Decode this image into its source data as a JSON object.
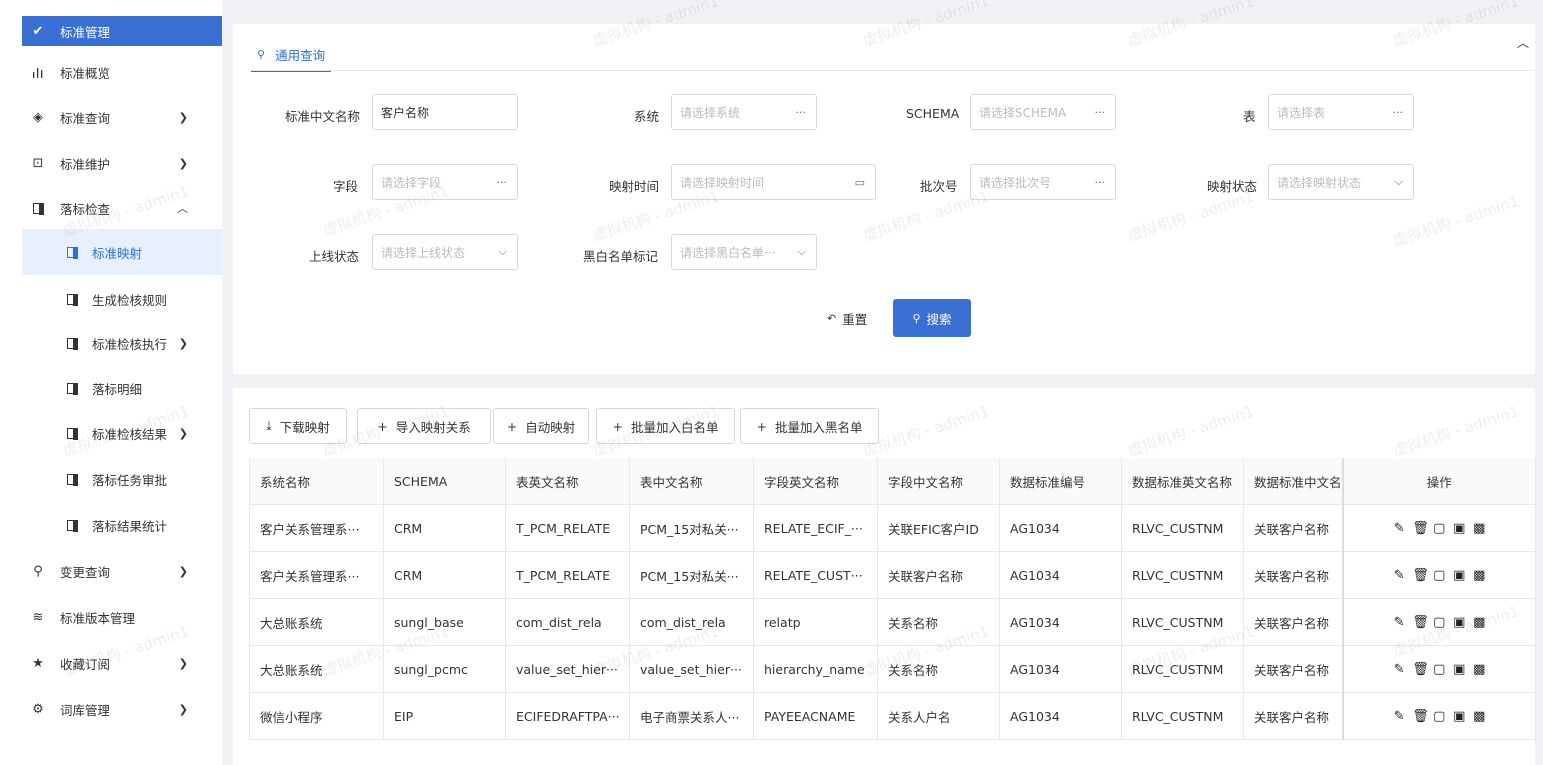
{
  "sidebar": {
    "items": [
      {
        "label": "标准管理",
        "icon": "shield-check-icon"
      },
      {
        "label": "标准概览",
        "icon": "bar-chart-icon"
      },
      {
        "label": "标准查询",
        "icon": "target-icon"
      },
      {
        "label": "标准维护",
        "icon": "box-icon"
      },
      {
        "label": "落标检查",
        "icon": "doc-icon"
      },
      {
        "label": "标准映射",
        "icon": "doc-icon"
      },
      {
        "label": "生成检核规则",
        "icon": "doc-icon"
      },
      {
        "label": "标准检核执行",
        "icon": "doc-icon"
      },
      {
        "label": "落标明细",
        "icon": "doc-icon"
      },
      {
        "label": "标准检核结果",
        "icon": "doc-icon"
      },
      {
        "label": "落标任务审批",
        "icon": "doc-icon"
      },
      {
        "label": "落标结果统计",
        "icon": "doc-icon"
      },
      {
        "label": "变更查询",
        "icon": "search-icon"
      },
      {
        "label": "标准版本管理",
        "icon": "layers-icon"
      },
      {
        "label": "收藏订阅",
        "icon": "star-icon"
      },
      {
        "label": "词库管理",
        "icon": "gear-icon"
      }
    ]
  },
  "query": {
    "tab_label": "通用查询",
    "fields": {
      "cn_name": {
        "label": "标准中文名称",
        "value": "客户名称"
      },
      "system": {
        "label": "系统",
        "placeholder": "请选择系统"
      },
      "schema": {
        "label": "SCHEMA",
        "placeholder": "请选择SCHEMA"
      },
      "table": {
        "label": "表",
        "placeholder": "请选择表"
      },
      "field": {
        "label": "字段",
        "placeholder": "请选择字段"
      },
      "map_time": {
        "label": "映射时间",
        "placeholder": "请选择映射时间"
      },
      "batch": {
        "label": "批次号",
        "placeholder": "请选择批次号"
      },
      "map_status": {
        "label": "映射状态",
        "placeholder": "请选择映射状态"
      },
      "online_status": {
        "label": "上线状态",
        "placeholder": "请选择上线状态"
      },
      "bw_flag": {
        "label": "黑白名单标记",
        "placeholder": "请选择黑白名单···"
      }
    },
    "reset_label": "重置",
    "search_label": "搜索"
  },
  "toolbar": {
    "download": "下载映射",
    "import": "导入映射关系",
    "auto": "自动映射",
    "whitelist": "批量加入白名单",
    "blacklist": "批量加入黑名单"
  },
  "table": {
    "headers": [
      "系统名称",
      "SCHEMA",
      "表英文名称",
      "表中文名称",
      "字段英文名称",
      "字段中文名称",
      "数据标准编号",
      "数据标准英文名称",
      "数据标准中文名称",
      "操作"
    ],
    "rows": [
      [
        "客户关系管理系···",
        "CRM",
        "T_PCM_RELATE",
        "PCM_15对私关···",
        "RELATE_ECIF_···",
        "关联EFIC客户ID",
        "AG1034",
        "RLVC_CUSTNM",
        "关联客户名称"
      ],
      [
        "客户关系管理系···",
        "CRM",
        "T_PCM_RELATE",
        "PCM_15对私关···",
        "RELATE_CUST···",
        "关联客户名称",
        "AG1034",
        "RLVC_CUSTNM",
        "关联客户名称"
      ],
      [
        "大总账系统",
        "sungl_base",
        "com_dist_rela",
        "com_dist_rela",
        "relatp",
        "关系名称",
        "AG1034",
        "RLVC_CUSTNM",
        "关联客户名称"
      ],
      [
        "大总账系统",
        "sungl_pcmc",
        "value_set_hier···",
        "value_set_hier···",
        "hierarchy_name",
        "关系名称",
        "AG1034",
        "RLVC_CUSTNM",
        "关联客户名称"
      ],
      [
        "微信小程序",
        "EIP",
        "ECIFEDRAFTPA···",
        "电子商票关系人···",
        "PAYEEACNAME",
        "关系人户名",
        "AG1034",
        "RLVC_CUSTNM",
        "关联客户名称"
      ]
    ]
  },
  "watermark": "虚拟机构 - admin1"
}
